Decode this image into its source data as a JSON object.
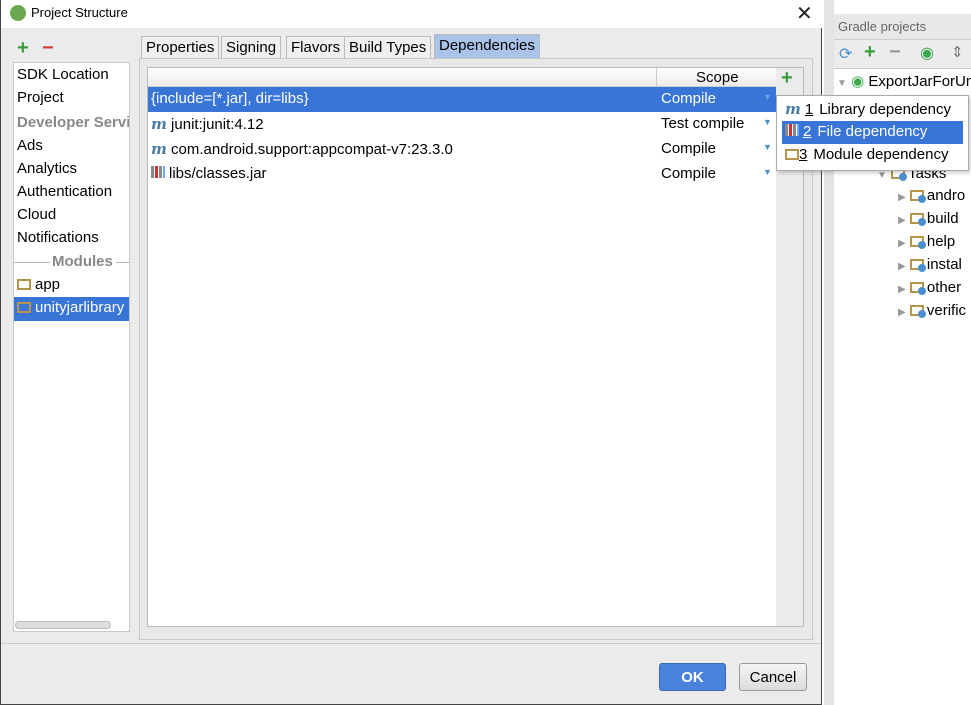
{
  "dialog": {
    "title": "Project Structure",
    "ok": "OK",
    "cancel": "Cancel"
  },
  "sidebar": {
    "items": [
      {
        "label": "SDK Location"
      },
      {
        "label": "Project"
      },
      {
        "label": "Developer Services"
      },
      {
        "label": "Ads"
      },
      {
        "label": "Analytics"
      },
      {
        "label": "Authentication"
      },
      {
        "label": "Cloud"
      },
      {
        "label": "Notifications"
      }
    ],
    "modules_header": "Modules",
    "modules": [
      {
        "label": "app"
      },
      {
        "label": "unityjarlibrary"
      }
    ]
  },
  "tabs": [
    {
      "label": "Properties"
    },
    {
      "label": "Signing"
    },
    {
      "label": "Flavors"
    },
    {
      "label": "Build Types"
    },
    {
      "label": "Dependencies",
      "active": true
    }
  ],
  "table": {
    "scope_header": "Scope",
    "rows": [
      {
        "name": "{include=[*.jar], dir=libs}",
        "scope": "Compile",
        "icon": "none"
      },
      {
        "name": "junit:junit:4.12",
        "scope": "Test compile",
        "icon": "maven-icon"
      },
      {
        "name": "com.android.support:appcompat-v7:23.3.0",
        "scope": "Compile",
        "icon": "maven-icon"
      },
      {
        "name": "libs/classes.jar",
        "scope": "Compile",
        "icon": "jar-icon"
      }
    ]
  },
  "popup": {
    "items": [
      {
        "num": "1",
        "label": "Library dependency"
      },
      {
        "num": "2",
        "label": "File dependency",
        "selected": true
      },
      {
        "num": "3",
        "label": "Module dependency"
      }
    ]
  },
  "gradle": {
    "title": "Gradle projects",
    "root": "ExportJarForUn",
    "tasks": "Tasks",
    "children": [
      "andro",
      "build",
      "help",
      "instal",
      "other",
      "verific"
    ]
  },
  "colors": {
    "selection": "#3875d7",
    "add": "#3a9b3a",
    "remove": "#d04040"
  }
}
